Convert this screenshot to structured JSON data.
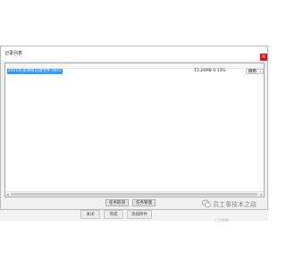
{
  "dialog": {
    "title": "记录列表",
    "close_glyph": "×"
  },
  "list": {
    "rows": [
      {
        "name": "2025年某项目记录文件.docx",
        "size": "13.24MB 0.13%",
        "action": "撤销"
      }
    ]
  },
  "buttons": {
    "cancel_label": "任务取消",
    "manage_label": "任务管理"
  },
  "background": {
    "btn1": "关闭",
    "btn2": "完成",
    "btn3": "添加附件"
  },
  "watermark": {
    "text": "员工事技术之路",
    "sub": "汇信教教"
  },
  "icons": {
    "close": "close-icon",
    "chevron": "chevron-down-icon",
    "scroll_left": "arrow-left-icon",
    "scroll_right": "arrow-right-icon",
    "logo": "wechat-logo-icon"
  },
  "colors": {
    "selection": "#3399ff",
    "close": "#e81123"
  }
}
